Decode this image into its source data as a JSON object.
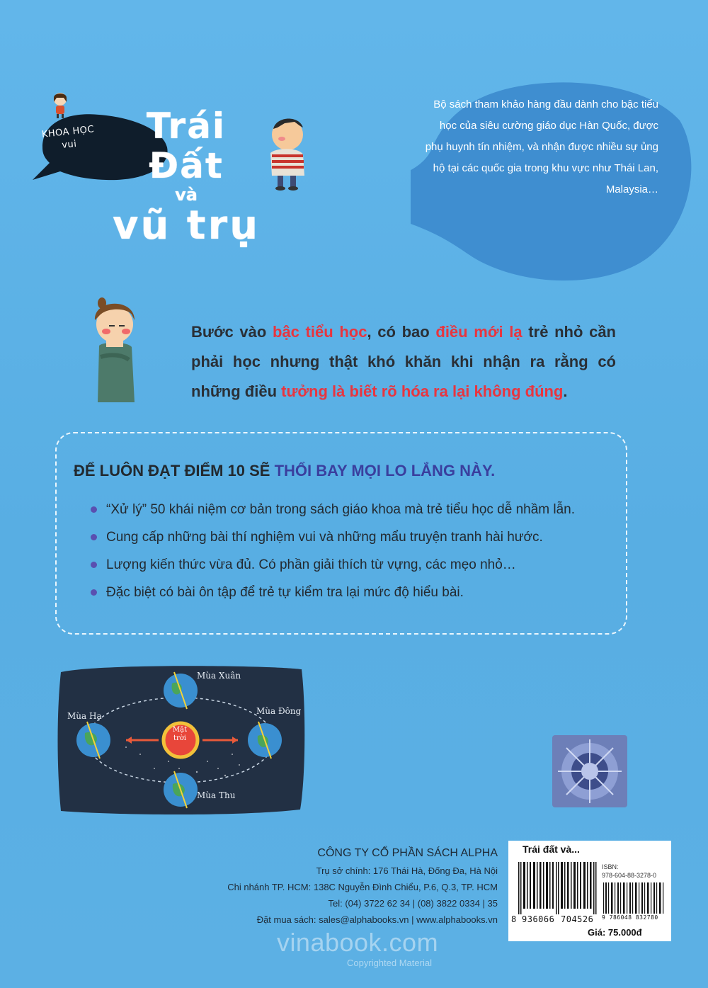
{
  "cover": {
    "series_label_line1": "KHOA HỌC",
    "series_label_line2": "vui",
    "title_line1": "Trái Đất",
    "title_line2": "và",
    "title_line3": "vũ trụ"
  },
  "speech_bubble": {
    "text": "Bộ sách tham khảo hàng đầu dành cho bậc tiểu học của siêu cường giáo dục Hàn Quốc, được phụ huynh tín nhiệm, và nhận được nhiều sự ủng hộ tại các quốc gia trong khu vực như Thái Lan, Malaysia…"
  },
  "intro": {
    "p1": "Bước vào ",
    "h1": "bậc tiểu học",
    "p2": ", có bao ",
    "h2": "điều mới lạ",
    "p3": " trẻ nhỏ cần phải học nhưng thật khó khăn khi nhận ra rằng có những điều ",
    "h3": "tưởng là biết rõ hóa ra lại không đúng",
    "p4": "."
  },
  "benefits": {
    "heading_plain": "ĐỂ LUÔN ĐẠT ĐIỂM 10 SẼ ",
    "heading_highlight": "THỔI BAY MỌI LO LẮNG NÀY.",
    "items": [
      "“Xử lý” 50 khái niệm cơ bản trong sách giáo khoa mà trẻ tiểu học dễ nhầm lẫn.",
      "Cung cấp những bài thí nghiệm vui và những mẩu truyện tranh hài hước.",
      "Lượng kiến thức vừa đủ. Có phần giải thích từ vựng, các mẹo nhỏ…",
      "Đặc biệt có bài ôn tập để trẻ tự kiểm tra lại mức độ hiểu bài."
    ]
  },
  "season_diagram": {
    "spring": "Mùa Xuân",
    "summer": "Mùa Hạ",
    "winter": "Mùa Đông",
    "autumn": "Mùa Thu",
    "sun_line1": "Mặt",
    "sun_line2": "trời"
  },
  "publisher": {
    "name": "CÔNG TY CỔ PHẦN SÁCH ALPHA",
    "hq": "Trụ sở chính: 176 Thái Hà, Đống Đa, Hà Nội",
    "branch": "Chi nhánh TP. HCM: 138C Nguyễn Đình Chiểu, P.6, Q.3, TP. HCM",
    "tel": "Tel: (04) 3722 62 34 | (08) 3822 0334 | 35",
    "order": "Đặt mua sách: sales@alphabooks.vn | www.alphabooks.vn"
  },
  "barcode": {
    "title": "Trái đất và...",
    "isbn_label": "ISBN:",
    "isbn": "978-604-88-3278-0",
    "digits_lead": "8",
    "digits_left": "936066",
    "digits_right": "704526",
    "digits_isbn": "9 786048 832780",
    "price": "Giá: 75.000đ"
  },
  "watermark": {
    "site": "vinabook.com",
    "copyright": "Copyrighted Material"
  },
  "colors": {
    "background": "#5fb2e6",
    "highlight_red": "#e8353f",
    "highlight_purple": "#3a3f9e",
    "bubble_dark": "#0f1d2b",
    "bubble_blue": "#3f8ed0"
  }
}
